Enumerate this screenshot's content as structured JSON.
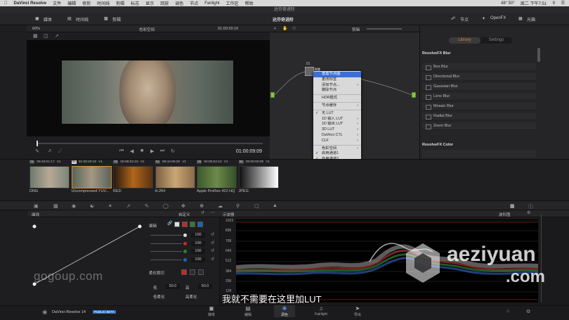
{
  "menubar": {
    "apple": "",
    "app": "DaVinci Resolve",
    "items": [
      "文件",
      "编辑",
      "修剪",
      "时间线",
      "剪辑",
      "标志",
      "显示",
      "回放",
      "调色",
      "节点",
      "Fairlight",
      "工作区",
      "帮助"
    ],
    "temp": "48° 50°",
    "datetime": "周二 下午7:51"
  },
  "window": {
    "title": "达芬奇进阶"
  },
  "toolbar": {
    "media": "媒体",
    "timeline": "时间线",
    "clip": "剪辑",
    "project": "达芬奇进阶",
    "nodes": "节点",
    "openfx": "OpenFX",
    "lightbox": "光箱"
  },
  "viewer": {
    "zoom": "60%",
    "colorspace": "色彩空间",
    "timecode": "01:00:29:10",
    "current_tc": "01:00:09:09"
  },
  "node_editor": {
    "mode": "剪辑",
    "node_label": "01",
    "node_name": "检查"
  },
  "context_menu": {
    "items": [
      {
        "label": "重置节点图",
        "selected": true
      },
      {
        "label": "更改标签"
      },
      {
        "label": "添加节点...",
        "arrow": true
      },
      {
        "label": "删除节点"
      },
      {
        "sep": true
      },
      {
        "label": "HDR模式"
      },
      {
        "sep": true
      },
      {
        "label": "节点缓存",
        "arrow": true
      },
      {
        "sep": true
      },
      {
        "label": "无 LUT",
        "check": true
      },
      {
        "label": "1D 输入 LUT",
        "arrow": true
      },
      {
        "label": "1D 输出 LUT",
        "arrow": true
      },
      {
        "label": "3D LUT",
        "arrow": true
      },
      {
        "label": "DaVinci CTL",
        "arrow": true
      },
      {
        "label": "CLF",
        "arrow": true
      },
      {
        "sep": true
      },
      {
        "label": "色彩空间",
        "arrow": true
      },
      {
        "label": "启用通道1",
        "check": true
      },
      {
        "label": "启用通道2",
        "check": true
      },
      {
        "label": "启用通道3",
        "check": true
      },
      {
        "label": "添加蒙版",
        "arrow": true
      }
    ]
  },
  "openfx": {
    "tab_library": "Library",
    "tab_settings": "Settings",
    "blur_title": "ResolveFX Blur",
    "blur_items": [
      "Box Blur",
      "Directional Blur",
      "Gaussian Blur",
      "Lens Blur",
      "Mosaic Blur",
      "Radial Blur",
      "Zoom Blur"
    ],
    "color_title": "ResolveFX Color"
  },
  "clips": [
    {
      "num": "01",
      "tc": "08:46:01:17",
      "track": "V1",
      "name": "DNG",
      "bg": "linear-gradient(90deg,#6d7a70,#b7aa96,#7a8478)"
    },
    {
      "num": "02",
      "tc": "01:00:29:10",
      "track": "V1",
      "name": "Uncompressed YUV...",
      "bg": "linear-gradient(90deg,#5a6558,#a59783,#59645a)"
    },
    {
      "num": "03",
      "tc": "00:08:02:23",
      "track": "V1",
      "name": "RED",
      "bg": "linear-gradient(90deg,#2a1a0e,#b0661c,#5a3312)"
    },
    {
      "num": "04",
      "tc": "09:44:06:20",
      "track": "V1",
      "name": "H.264",
      "bg": "linear-gradient(90deg,#7b6244,#c9a676,#8a6b48)"
    },
    {
      "num": "05",
      "tc": "00:00:52:10",
      "track": "V1",
      "name": "Apple ProRes 422 HQ",
      "bg": "linear-gradient(90deg,#3d5a2a,#6b8a4a,#35502a)"
    },
    {
      "num": "06",
      "tc": "00:00:00:00",
      "track": "V1",
      "name": "JPEG",
      "bg": "linear-gradient(90deg,#111,#888,#fff)"
    }
  ],
  "curves": {
    "title": "曲线",
    "preset": "自定义",
    "edit": "编辑",
    "values": [
      "100",
      "100",
      "100",
      "100"
    ],
    "soft_clip": "柔化裁切",
    "low_label": "低",
    "low_val": "50.0",
    "high_label": "高",
    "high_val": "50.0",
    "low_soft": "低柔化",
    "high_soft": "高柔化"
  },
  "scope": {
    "title": "示波器",
    "mode": "波形图",
    "ticks": [
      "1023",
      "896",
      "768",
      "640",
      "512",
      "384",
      "256",
      "128",
      "0"
    ]
  },
  "subtitle": "我就不需要在这里加LUT",
  "watermark": {
    "left": "gogoup.com",
    "right1": "aeziyuan",
    "right2": ".com"
  },
  "footer": {
    "app": "DaVinci Resolve 14",
    "badge": "PUBLIC BETA",
    "pages": [
      "媒体",
      "编辑",
      "调色",
      "Fairlight",
      "导出"
    ]
  }
}
